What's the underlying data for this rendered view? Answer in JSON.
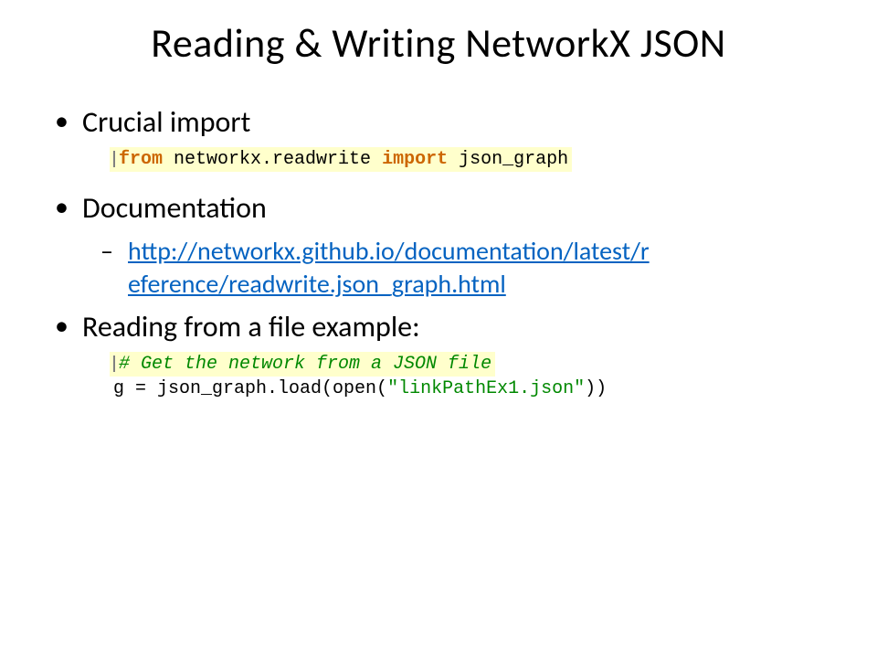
{
  "title": "Reading & Writing NetworkX JSON",
  "bullets": {
    "b1": "Crucial import",
    "b2": "Documentation",
    "b3": "Reading from a file example:"
  },
  "link": {
    "line1": "http://networkx.github.io/documentation/latest/r",
    "line2": "eference/readwrite.json_graph.html"
  },
  "code1": {
    "kw_from": "from",
    "module": " networkx.readwrite ",
    "kw_import": "import",
    "target": " json_graph"
  },
  "code2": {
    "comment": "# Get the network from a JSON file",
    "var": "g = json_graph.load(open(",
    "string": "\"linkPathEx1.json\"",
    "close": "))"
  }
}
